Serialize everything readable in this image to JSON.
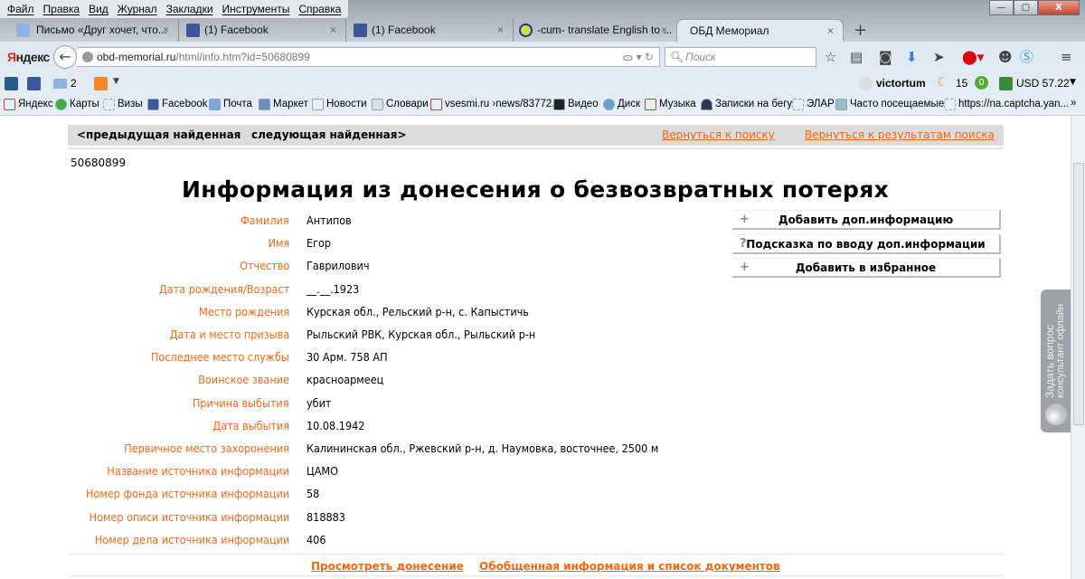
{
  "browser": {
    "menu": [
      "Файл",
      "Правка",
      "Вид",
      "Журнал",
      "Закладки",
      "Инструменты",
      "Справка"
    ],
    "tabs": [
      {
        "label": "Письмо «Друг хочет, что...",
        "icon": "mail-icon"
      },
      {
        "label": "(1) Facebook",
        "icon": "facebook-icon"
      },
      {
        "label": "(1) Facebook",
        "icon": "facebook-icon"
      },
      {
        "label": "-cum- translate English to ...",
        "icon": "c-icon"
      },
      {
        "label": "ОБД Мемориал",
        "active": true
      }
    ],
    "close": "×",
    "newtab": "+",
    "logo_red": "Я",
    "logo_rest": "ндекс",
    "url_host": "obd-memorial.ru",
    "url_path": "/html/info.htm?id=50680899",
    "search_placeholder": "Поиск",
    "mail_count": "2",
    "user": "victortum",
    "weather": "15",
    "green_badge": "0",
    "currency": "USD 57.22",
    "bookmarks": [
      "Яндекс",
      "Карты",
      "Визы",
      "Facebook",
      "Почта",
      "Маркет",
      "Новости",
      "Словари",
      "vsesmi.ru ›news/83772...",
      "Видео",
      "Диск",
      "Музыка",
      "Записки на бегу",
      "ЭЛАР",
      "Часто посещаемые",
      "https://na.captcha.yan..."
    ],
    "more": "»"
  },
  "consult": {
    "line1": "Задать вопрос",
    "line2": "консультант офлайн"
  },
  "nav": {
    "prev": "<предыдущая найденная",
    "next": "следующая найденная>",
    "back_search": "Вернуться к поиску",
    "back_results": "Вернуться к результатам поиска"
  },
  "record_id": "50680899",
  "title": "Информация из донесения о безвозвратных потерях",
  "fields": [
    {
      "label": "Фамилия",
      "value": "Антипов"
    },
    {
      "label": "Имя",
      "value": "Егор"
    },
    {
      "label": "Отчество",
      "value": "Гаврилович"
    },
    {
      "label": "Дата рождения/Возраст",
      "value": "__.__.1923"
    },
    {
      "label": "Место рождения",
      "value": "Курская обл., Рельский р-н, с. Капыстичь"
    },
    {
      "label": "Дата и место призыва",
      "value": "Рыльский РВК, Курская обл., Рыльский р-н"
    },
    {
      "label": "Последнее место службы",
      "value": "30 Арм. 758 АП"
    },
    {
      "label": "Воинское звание",
      "value": "красноармеец"
    },
    {
      "label": "Причина выбытия",
      "value": "убит"
    },
    {
      "label": "Дата выбытия",
      "value": "10.08.1942"
    },
    {
      "label": "Первичное место захоронения",
      "value": "Калининская обл., Ржевский р-н, д. Наумовка, восточнее, 2500 м"
    },
    {
      "label": "Название источника информации",
      "value": "ЦАМО"
    },
    {
      "label": "Номер фонда источника информации",
      "value": "58"
    },
    {
      "label": "Номер описи источника информации",
      "value": "818883"
    },
    {
      "label": "Номер дела источника информации",
      "value": "406"
    }
  ],
  "actions": [
    {
      "glyph": "+",
      "label": "Добавить доп.информацию"
    },
    {
      "glyph": "?",
      "label": "Подсказка по вводу доп.информации"
    },
    {
      "glyph": "+",
      "label": "Добавить в избранное"
    }
  ],
  "footer": {
    "view": "Просмотреть донесение",
    "summary": "Обобщенная информация и список документов"
  },
  "colors": {
    "accent": "#ee6a1a",
    "bar": "#dcdcdc"
  }
}
